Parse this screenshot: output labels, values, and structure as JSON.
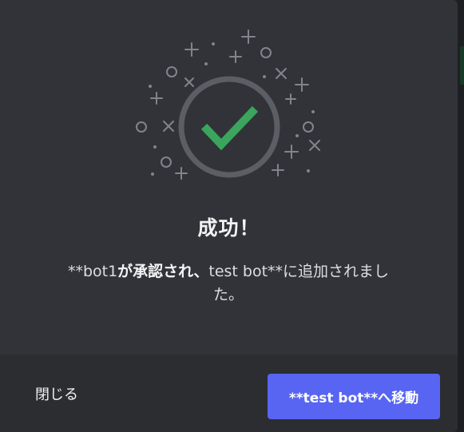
{
  "dialog": {
    "title": "成功！",
    "message_prefix": "**bot1",
    "message_bold": "が承認され、",
    "message_suffix": "test bot**に追加されました。"
  },
  "footer": {
    "close_label": "閉じる",
    "primary_label": "**test bot**へ移動"
  },
  "colors": {
    "check": "#3ba55d",
    "ring": "#5c5e66",
    "primary": "#5865f2",
    "sparkle": "#80848e"
  },
  "icons": {
    "success": "checkmark-icon"
  }
}
